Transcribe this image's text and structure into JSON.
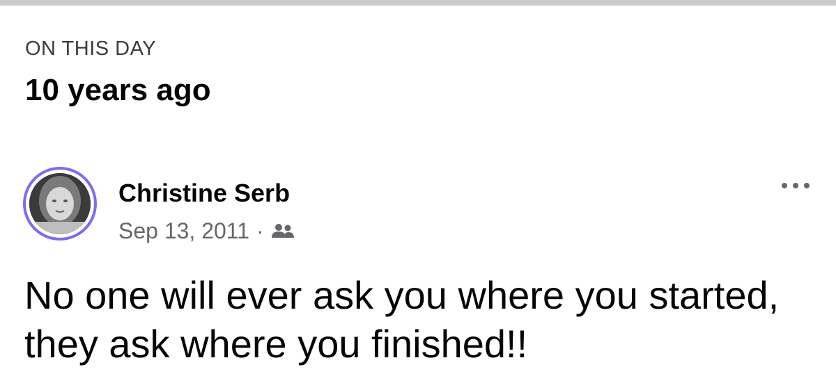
{
  "memories": {
    "section_label": "ON THIS DAY",
    "section_title": "10 years ago"
  },
  "post": {
    "author_name": "Christine Serb",
    "date": "Sep 13, 2011",
    "separator": "·",
    "audience_icon": "friends-icon",
    "more_icon": "more-options-icon",
    "text": "No one will ever ask you where you started, they ask where you finished!!"
  },
  "colors": {
    "avatar_ring": "#7b6cf2",
    "secondary_text": "#65676b",
    "primary_text": "#050505",
    "top_bar": "#c9cbcf"
  }
}
